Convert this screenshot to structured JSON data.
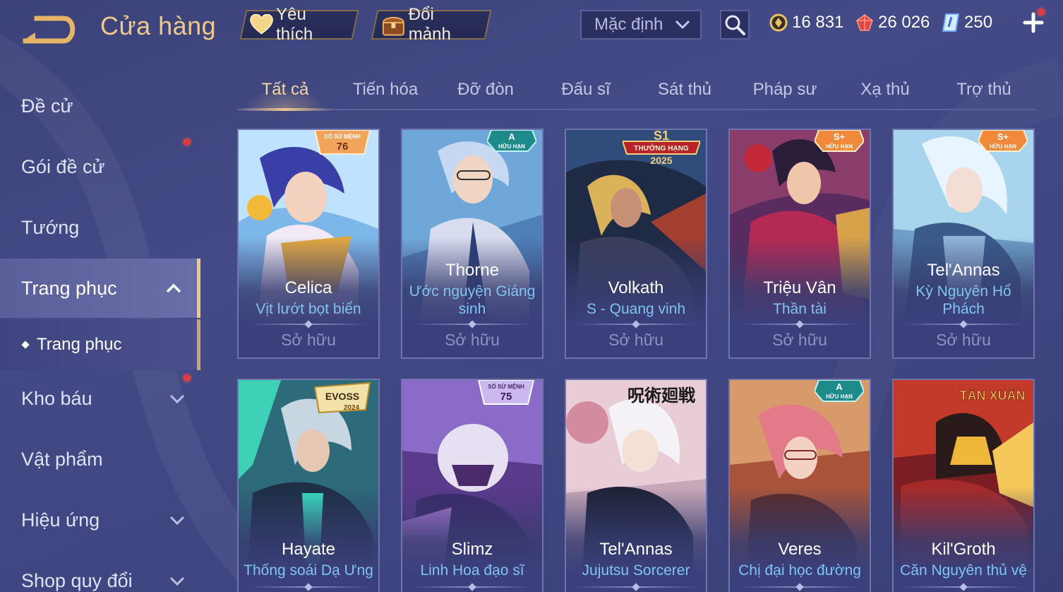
{
  "header": {
    "title": "Cửa hàng",
    "favorite_label": "Yêu thích",
    "exchange_label": "Đổi mảnh",
    "sort_label": "Mặc định",
    "currencies": {
      "gold": "16 831",
      "ruby": "26 026",
      "voucher": "250"
    }
  },
  "sidebar": {
    "items": [
      {
        "label": "Đề cử"
      },
      {
        "label": "Gói đề cử"
      },
      {
        "label": "Tướng"
      },
      {
        "label": "Trang phục"
      },
      {
        "label": "Kho báu"
      },
      {
        "label": "Vật phẩm"
      },
      {
        "label": "Hiệu ứng"
      },
      {
        "label": "Shop quy đổi"
      }
    ],
    "sub_item": "Trang phục"
  },
  "tabs": [
    "Tất cả",
    "Tiến hóa",
    "Đỡ đòn",
    "Đấu sĩ",
    "Sát thủ",
    "Pháp sư",
    "Xạ thủ",
    "Trợ thủ"
  ],
  "cards": [
    {
      "hero": "Celica",
      "skin": "Vịt lướt bọt biển",
      "status": "Sở hữu",
      "badge_top": "SỐ SỨ MỆNH",
      "badge_main": "76"
    },
    {
      "hero": "Thorne",
      "skin": "Ước nguyện Giáng sinh",
      "status": "Sở hữu",
      "badge_main": "A",
      "badge_top": "HỮU HẠN"
    },
    {
      "hero": "Volkath",
      "skin": "S - Quang vinh",
      "status": "Sở hữu",
      "badge_main": "S1",
      "badge_top": "THƯỞNG HẠNG",
      "badge_sub": "2025"
    },
    {
      "hero": "Triệu Vân",
      "skin": "Thần tài",
      "status": "Sở hữu",
      "badge_main": "S+",
      "badge_top": "HỮU HẠN"
    },
    {
      "hero": "Tel'Annas",
      "skin": "Kỳ Nguyên Hổ Phách",
      "status": "Sở hữu",
      "badge_main": "S+",
      "badge_top": "HỮU HẠN"
    },
    {
      "hero": "Hayate",
      "skin": "Thống soái Dạ Ưng",
      "badge_main": "EVOSS",
      "badge_sub": "2024"
    },
    {
      "hero": "Slimz",
      "skin": "Linh Hoa đạo sĩ",
      "badge_top": "SỐ SỨ MỆNH",
      "badge_main": "75"
    },
    {
      "hero": "Tel'Annas",
      "skin": "Jujutsu Sorcerer",
      "badge_main": "呪術廻戦"
    },
    {
      "hero": "Veres",
      "skin": "Chị đại học đường",
      "badge_main": "A",
      "badge_top": "HỮU HẠN"
    },
    {
      "hero": "Kil'Groth",
      "skin": "Căn Nguyên thủ vệ",
      "badge_main": "TÂN XUÂN"
    }
  ],
  "colors": {
    "accent_gold": "#f0c98a",
    "skin_name_blue": "#7fc3f0",
    "background": "#444a86",
    "notification_red": "#e23a3a"
  },
  "icons": [
    "back-arrow-icon",
    "heart-icon",
    "treasure-chest-icon",
    "chevron-down-icon",
    "search-icon",
    "gold-coin-icon",
    "ruby-gem-icon",
    "voucher-icon",
    "plus-icon",
    "chevron-up-icon"
  ]
}
